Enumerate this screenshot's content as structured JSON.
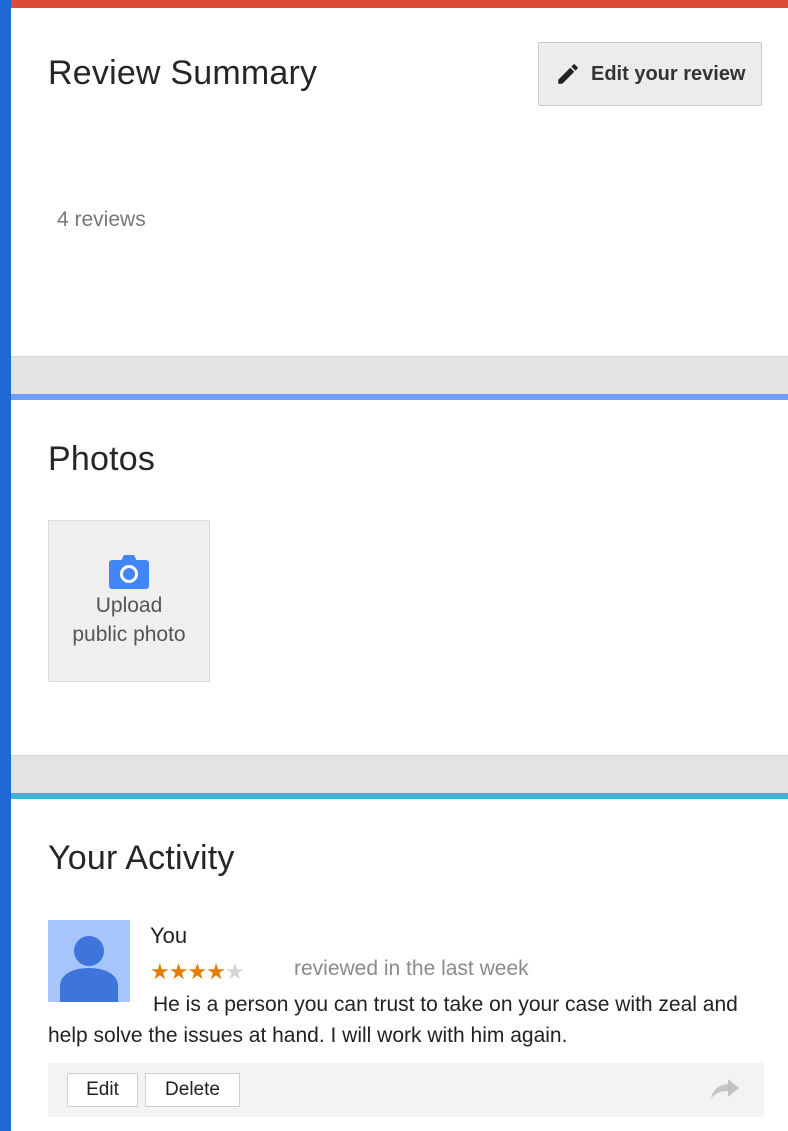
{
  "review_summary": {
    "title": "Review Summary",
    "edit_button_label": "Edit your review",
    "reviews_count": "4 reviews"
  },
  "photos": {
    "title": "Photos",
    "upload_line1": "Upload",
    "upload_line2": "public photo"
  },
  "activity": {
    "title": "Your Activity",
    "review": {
      "author": "You",
      "rating": 4,
      "rating_max": 5,
      "time": "reviewed in the last week",
      "text": "He is a person you can trust to take on your case with zeal and help solve the issues at hand. I will work with him again."
    },
    "actions": {
      "edit_label": "Edit",
      "delete_label": "Delete"
    }
  },
  "colors": {
    "summary_accent": "#dd4b39",
    "photos_accent": "#6d9eff",
    "activity_accent": "#3fb4d4",
    "star_on": "#e67c00",
    "star_off": "#d5d5d5"
  }
}
